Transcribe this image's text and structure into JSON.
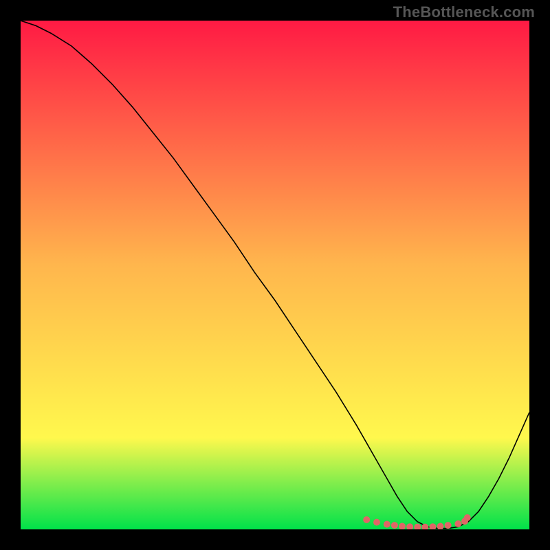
{
  "watermark": "TheBottleneck.com",
  "chart_data": {
    "type": "line",
    "title": "",
    "xlabel": "",
    "ylabel": "",
    "xlim": [
      0,
      100
    ],
    "ylim": [
      0,
      100
    ],
    "grid": false,
    "background_gradient": {
      "top": "#ff1a44",
      "mid1": "#ffb64d",
      "mid2": "#fff84d",
      "bottom": "#00e24a"
    },
    "series": [
      {
        "name": "curve",
        "color": "#000000",
        "width": 1.6,
        "x": [
          0,
          3,
          6,
          10,
          14,
          18,
          22,
          26,
          30,
          34,
          38,
          42,
          46,
          50,
          54,
          58,
          62,
          66,
          68,
          70,
          72,
          74,
          76,
          78,
          80,
          82,
          84,
          86,
          88,
          90,
          92,
          94,
          96,
          98,
          100
        ],
        "values": [
          100,
          99,
          97.5,
          95,
          91.5,
          87.5,
          83,
          78,
          73,
          67.5,
          62,
          56.5,
          50.5,
          45,
          39,
          33,
          27,
          20.5,
          17,
          13.5,
          10,
          6.5,
          3.5,
          1.5,
          0.5,
          0.2,
          0.2,
          0.5,
          1.5,
          3.5,
          6.5,
          10,
          14,
          18.5,
          23
        ]
      },
      {
        "name": "flat-zone-markers",
        "color": "#e06666",
        "marker_radius": 5,
        "x": [
          68,
          70,
          72,
          73.5,
          75,
          76.5,
          78,
          79.5,
          81,
          82.5,
          84,
          86,
          87.3,
          87.8
        ],
        "values": [
          1.9,
          1.4,
          1.0,
          0.8,
          0.6,
          0.5,
          0.45,
          0.45,
          0.5,
          0.6,
          0.8,
          1.1,
          1.6,
          2.3
        ]
      }
    ]
  }
}
